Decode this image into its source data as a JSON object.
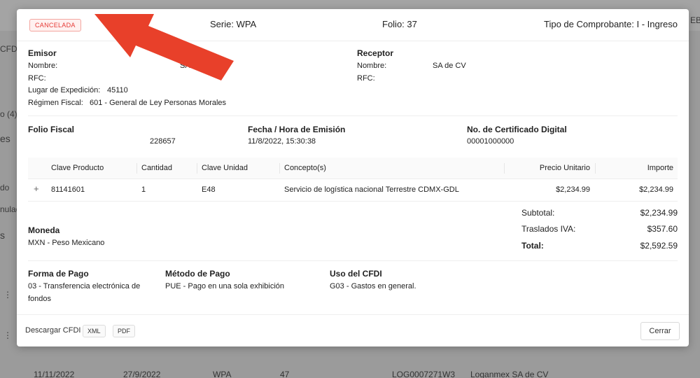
{
  "background": {
    "topbar_right": "EB I",
    "side_fragments": [
      "CFDI",
      "o (4)",
      "es",
      "do",
      "nulad",
      "s"
    ],
    "row": [
      "11/11/2022",
      "27/9/2022",
      "WPA",
      "47",
      "LOG0007271W3",
      "Loganmex SA de CV"
    ]
  },
  "header": {
    "status_badge": "CANCELADA",
    "serie": "Serie: WPA",
    "folio": "Folio: 37",
    "tipo": "Tipo de Comprobante: I - Ingreso"
  },
  "emisor": {
    "title": "Emisor",
    "nombre_label": "Nombre:",
    "nombre_value": "SA de CV",
    "rfc_label": "RFC:",
    "rfc_value": "",
    "lugar_label": "Lugar de Expedición:",
    "lugar_value": "45110",
    "regimen_label": "Régimen Fiscal:",
    "regimen_value": "601 - General de Ley Personas Morales"
  },
  "receptor": {
    "title": "Receptor",
    "nombre_label": "Nombre:",
    "nombre_value": "SA de CV",
    "rfc_label": "RFC:",
    "rfc_value": ""
  },
  "info": {
    "folio_fiscal_title": "Folio Fiscal",
    "folio_fiscal_value": "228657",
    "fecha_title": "Fecha / Hora de Emisión",
    "fecha_value": "11/8/2022, 15:30:38",
    "certificado_title": "No. de Certificado Digital",
    "certificado_value": "00001000000"
  },
  "table": {
    "headers": [
      "Clave Producto",
      "Cantidad",
      "Clave Unidad",
      "Concepto(s)",
      "Precio Unitario",
      "Importe"
    ],
    "rows": [
      {
        "expand": "+",
        "clave_producto": "81141601",
        "cantidad": "1",
        "clave_unidad": "E48",
        "concepto": "Servicio de logística nacional Terrestre CDMX-GDL",
        "precio_unitario": "$2,234.99",
        "importe": "$2,234.99"
      }
    ]
  },
  "totals": {
    "subtotal_label": "Subtotal:",
    "subtotal_value": "$2,234.99",
    "iva_label": "Traslados IVA:",
    "iva_value": "$357.60",
    "total_label": "Total:",
    "total_value": "$2,592.59"
  },
  "moneda": {
    "title": "Moneda",
    "value": "MXN - Peso Mexicano"
  },
  "pago": {
    "forma_title": "Forma de Pago",
    "forma_value_1": "03 - Transferencia electrónica de",
    "forma_value_2": "fondos",
    "metodo_title": "Método de Pago",
    "metodo_value": "PUE - Pago en una sola exhibición",
    "uso_title": "Uso del CFDI",
    "uso_value": "G03 - Gastos en general."
  },
  "footer": {
    "download_label": "Descargar CFDI",
    "xml_button": "XML",
    "pdf_button": "PDF",
    "close_button": "Cerrar"
  },
  "colors": {
    "badge_red": "#e53935",
    "arrow_red": "#e8402a"
  }
}
